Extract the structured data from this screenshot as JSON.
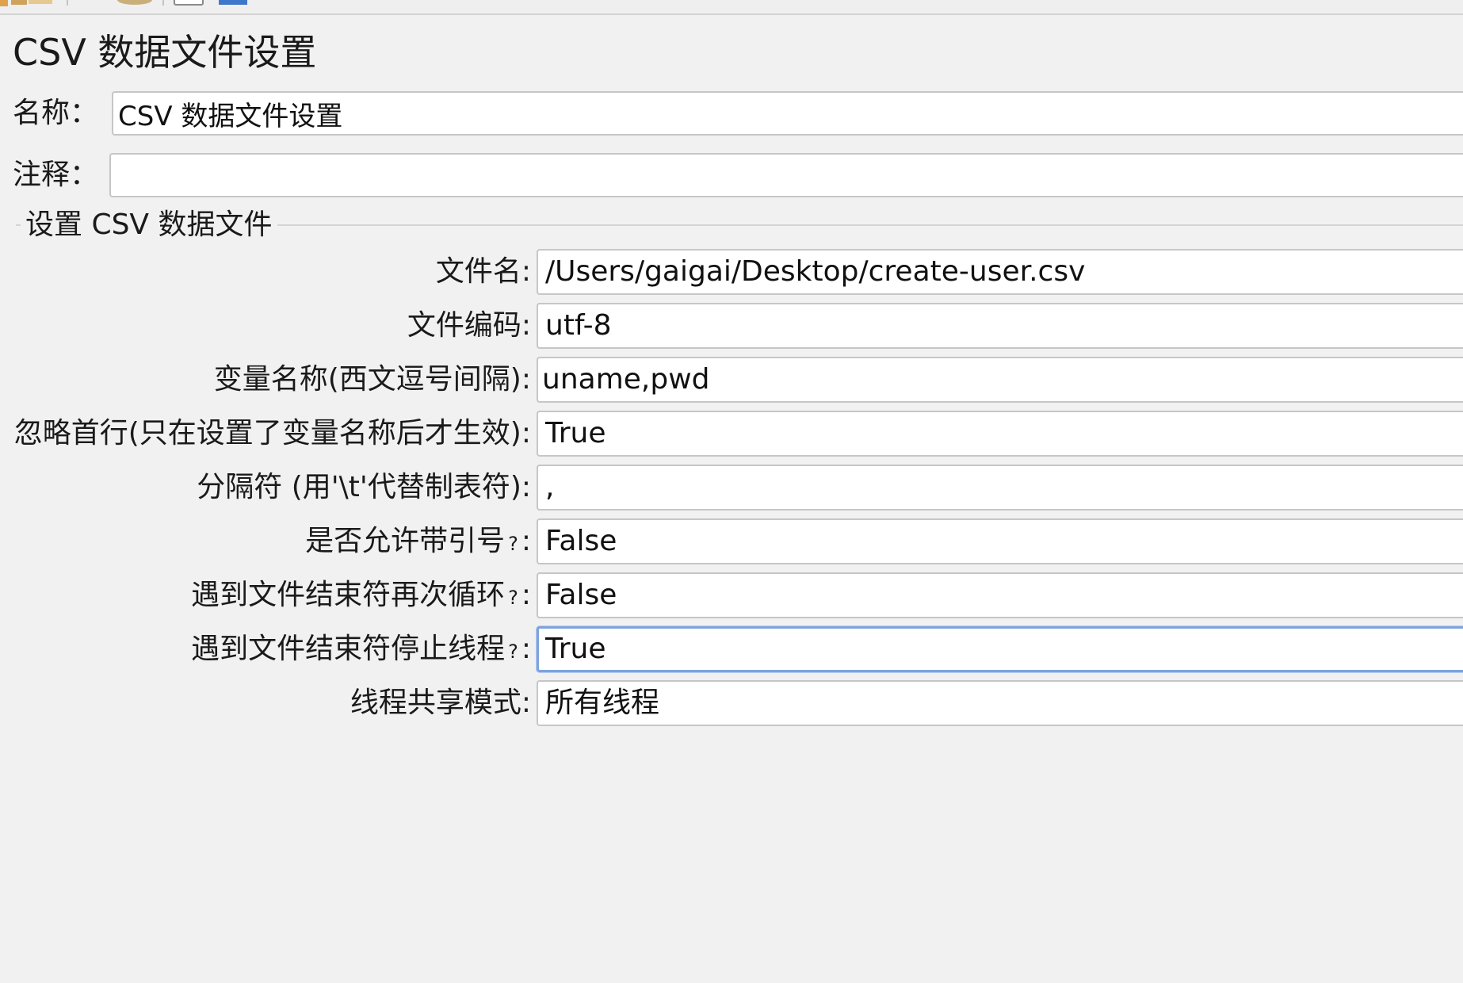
{
  "page_title": "CSV 数据文件设置",
  "name_field": {
    "label": "名称：",
    "value": "CSV 数据文件设置"
  },
  "comment_field": {
    "label": "注释：",
    "value": ""
  },
  "section": {
    "legend": "设置 CSV 数据文件",
    "fields": [
      {
        "label": "文件名:",
        "value": "/Users/gaigai/Desktop/create-user.csv"
      },
      {
        "label": "文件编码:",
        "value": "utf-8"
      },
      {
        "label": "变量名称(西文逗号间隔):",
        "value": "uname,pwd"
      },
      {
        "label": "忽略首行(只在设置了变量名称后才生效):",
        "value": "True"
      },
      {
        "label": "分隔符 (用'\\t'代替制表符):",
        "value": ","
      },
      {
        "label": "是否允许带引号",
        "value": "False"
      },
      {
        "label": "遇到文件结束符再次循环",
        "value": "False"
      },
      {
        "label": "遇到文件结束符停止线程",
        "value": "True"
      },
      {
        "label": "线程共享模式:",
        "value": "所有线程"
      }
    ],
    "question_suffix": "?",
    "colon": ":"
  }
}
